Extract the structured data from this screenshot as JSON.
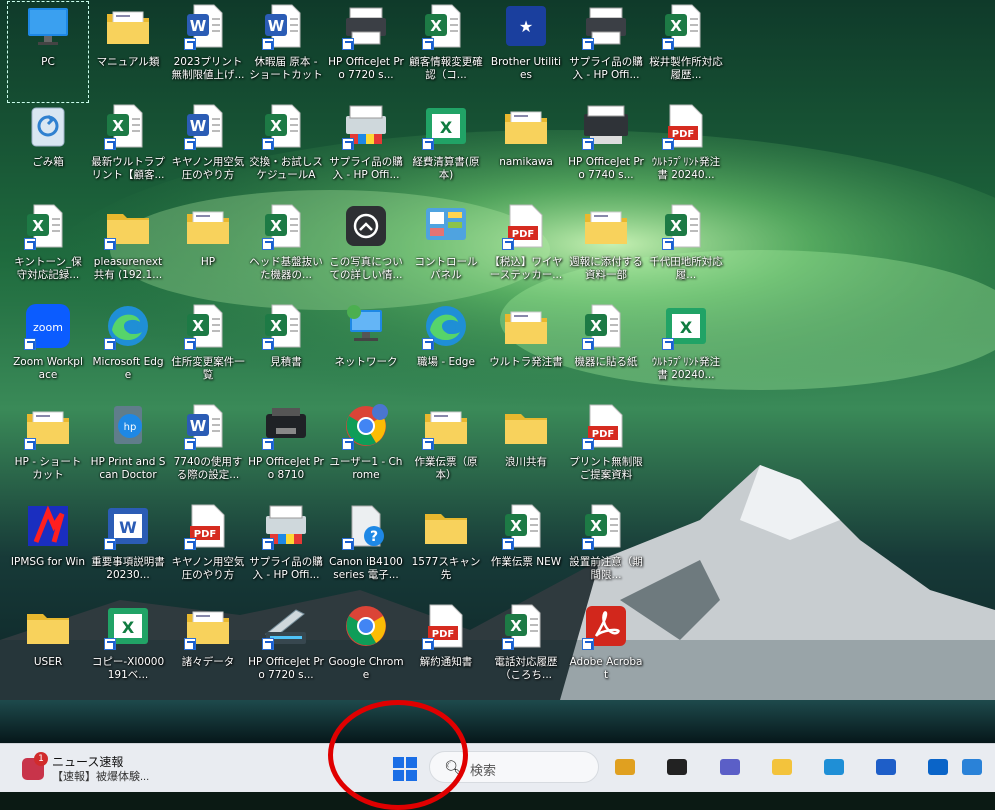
{
  "desktop": {
    "icons": [
      {
        "label": "PC",
        "type": "monitor"
      },
      {
        "label": "マニュアル類",
        "type": "folder-doc"
      },
      {
        "label": "2023プリント無制限値上げ...",
        "type": "word",
        "shortcut": true
      },
      {
        "label": "休暇届 原本 - ショートカット",
        "type": "word",
        "shortcut": true
      },
      {
        "label": "HP OfficeJet Pro 7720 s...",
        "type": "printer",
        "shortcut": true
      },
      {
        "label": "顧客情報変更確認（コ...",
        "type": "excel",
        "shortcut": true
      },
      {
        "label": "Brother Utilities",
        "type": "brother"
      },
      {
        "label": "サプライ品の購入 - HP Offi...",
        "type": "printer",
        "shortcut": true
      },
      {
        "label": "桜井製作所対応履歴...",
        "type": "excel",
        "shortcut": true
      },
      {
        "label": "ごみ箱",
        "type": "recycle"
      },
      {
        "label": "最新ウルトラプリント【顧客...",
        "type": "excel",
        "shortcut": true
      },
      {
        "label": "キヤノン用空気圧のやり方",
        "type": "word",
        "shortcut": true
      },
      {
        "label": "交換・お試しスケジュールA",
        "type": "excel",
        "shortcut": true
      },
      {
        "label": "サプライ品の購入 - HP Offi...",
        "type": "printer-color",
        "shortcut": true
      },
      {
        "label": "経費清算書(原本)",
        "type": "excel-green",
        "shortcut": true
      },
      {
        "label": "namikawa",
        "type": "folder-doc"
      },
      {
        "label": "HP OfficeJet Pro 7740 s...",
        "type": "printer-big",
        "shortcut": true
      },
      {
        "label": "ｳﾙﾄﾗﾌﾟﾘﾝﾄ発注書 20240...",
        "type": "pdf",
        "shortcut": true
      },
      {
        "label": "キントーン_保守対応記録...",
        "type": "excel",
        "shortcut": true
      },
      {
        "label": "pleasurenext 共有 (192.1...",
        "type": "folder",
        "shortcut": true
      },
      {
        "label": "HP",
        "type": "folder-doc"
      },
      {
        "label": "ヘッド基盤抜いた機器の...",
        "type": "excel",
        "shortcut": true
      },
      {
        "label": "この写真についての詳しい情...",
        "type": "camera"
      },
      {
        "label": "コントロール パネル",
        "type": "control"
      },
      {
        "label": "【税込】ワイヤーステッカー...",
        "type": "pdf",
        "shortcut": true
      },
      {
        "label": "週報に添付する資料一部",
        "type": "folder-doc"
      },
      {
        "label": "千代田地所対応履...",
        "type": "excel",
        "shortcut": true
      },
      {
        "label": "Zoom Workplace",
        "type": "zoom",
        "shortcut": true
      },
      {
        "label": "Microsoft Edge",
        "type": "edge",
        "shortcut": true
      },
      {
        "label": "住所変更案件一覧",
        "type": "excel",
        "shortcut": true
      },
      {
        "label": "見積書",
        "type": "excel",
        "shortcut": true
      },
      {
        "label": "ネットワーク",
        "type": "network"
      },
      {
        "label": "職場 - Edge",
        "type": "edge",
        "shortcut": true
      },
      {
        "label": "ウルトラ発注書",
        "type": "folder-doc"
      },
      {
        "label": "機器に貼る紙",
        "type": "excel",
        "shortcut": true
      },
      {
        "label": "ｳﾙﾄﾗﾌﾟﾘﾝﾄ発注書 20240...",
        "type": "excel-green",
        "shortcut": true
      },
      {
        "label": "HP - ショートカット",
        "type": "folder-doc",
        "shortcut": true
      },
      {
        "label": "HP Print and Scan Doctor",
        "type": "hpdoctor"
      },
      {
        "label": "7740の使用する際の設定...",
        "type": "word",
        "shortcut": true
      },
      {
        "label": "HP OfficeJet Pro 8710",
        "type": "printer-black",
        "shortcut": true
      },
      {
        "label": "ユーザー1 - Chrome",
        "type": "chrome-user",
        "shortcut": true
      },
      {
        "label": "作業伝票（原本）",
        "type": "folder-doc",
        "shortcut": true
      },
      {
        "label": "浪川共有",
        "type": "folder"
      },
      {
        "label": "プリント無制限ご提案資料",
        "type": "pdf",
        "shortcut": true
      },
      {
        "label": "",
        "type": "none"
      },
      {
        "label": "IPMSG for Win",
        "type": "ipmsg"
      },
      {
        "label": "重要事項説明書20230...",
        "type": "word-blue",
        "shortcut": true
      },
      {
        "label": "キヤノン用空気圧のやり方",
        "type": "pdf",
        "shortcut": true
      },
      {
        "label": "サプライ品の購入 - HP Offi...",
        "type": "printer-color",
        "shortcut": true
      },
      {
        "label": "Canon iB4100 series 電子...",
        "type": "help",
        "shortcut": true
      },
      {
        "label": "1577スキャン先",
        "type": "folder"
      },
      {
        "label": "作業伝票 NEW",
        "type": "excel",
        "shortcut": true
      },
      {
        "label": "設置前注意（期間限...",
        "type": "excel",
        "shortcut": true
      },
      {
        "label": "",
        "type": "none"
      },
      {
        "label": "USER",
        "type": "folder"
      },
      {
        "label": "コピー-XI0000191ベ...",
        "type": "excel-green",
        "shortcut": true
      },
      {
        "label": "諸々データ",
        "type": "folder-doc",
        "shortcut": true
      },
      {
        "label": "HP OfficeJet Pro 7720 s...",
        "type": "scanner",
        "shortcut": true
      },
      {
        "label": "Google Chrome",
        "type": "chrome"
      },
      {
        "label": "解約通知書",
        "type": "pdf",
        "shortcut": true
      },
      {
        "label": "電話対応履歴（ころち...",
        "type": "excel",
        "shortcut": true
      },
      {
        "label": "Adobe Acrobat",
        "type": "acrobat",
        "shortcut": true
      },
      {
        "label": "",
        "type": "none"
      }
    ]
  },
  "taskbar": {
    "news_title": "ニュース速報",
    "news_sub": "【速報】被爆体験...",
    "news_badge": "1",
    "search_placeholder": "検索",
    "apps": [
      {
        "name": "briefcase-icon",
        "color": "#e0a020"
      },
      {
        "name": "task-view-icon",
        "color": "#222"
      },
      {
        "name": "chat-icon",
        "color": "#5b5fc7"
      },
      {
        "name": "file-explorer-icon",
        "color": "#f3c33c"
      },
      {
        "name": "edge-icon",
        "color": "#1f8fd6"
      },
      {
        "name": "store-icon",
        "color": "#1e5ec8"
      },
      {
        "name": "outlook-icon",
        "color": "#0a64c8"
      },
      {
        "name": "remote-desktop-icon",
        "color": "#2a82d8"
      }
    ]
  },
  "colors": {
    "accent": "#1a6ee6",
    "annotation": "#e00000"
  }
}
